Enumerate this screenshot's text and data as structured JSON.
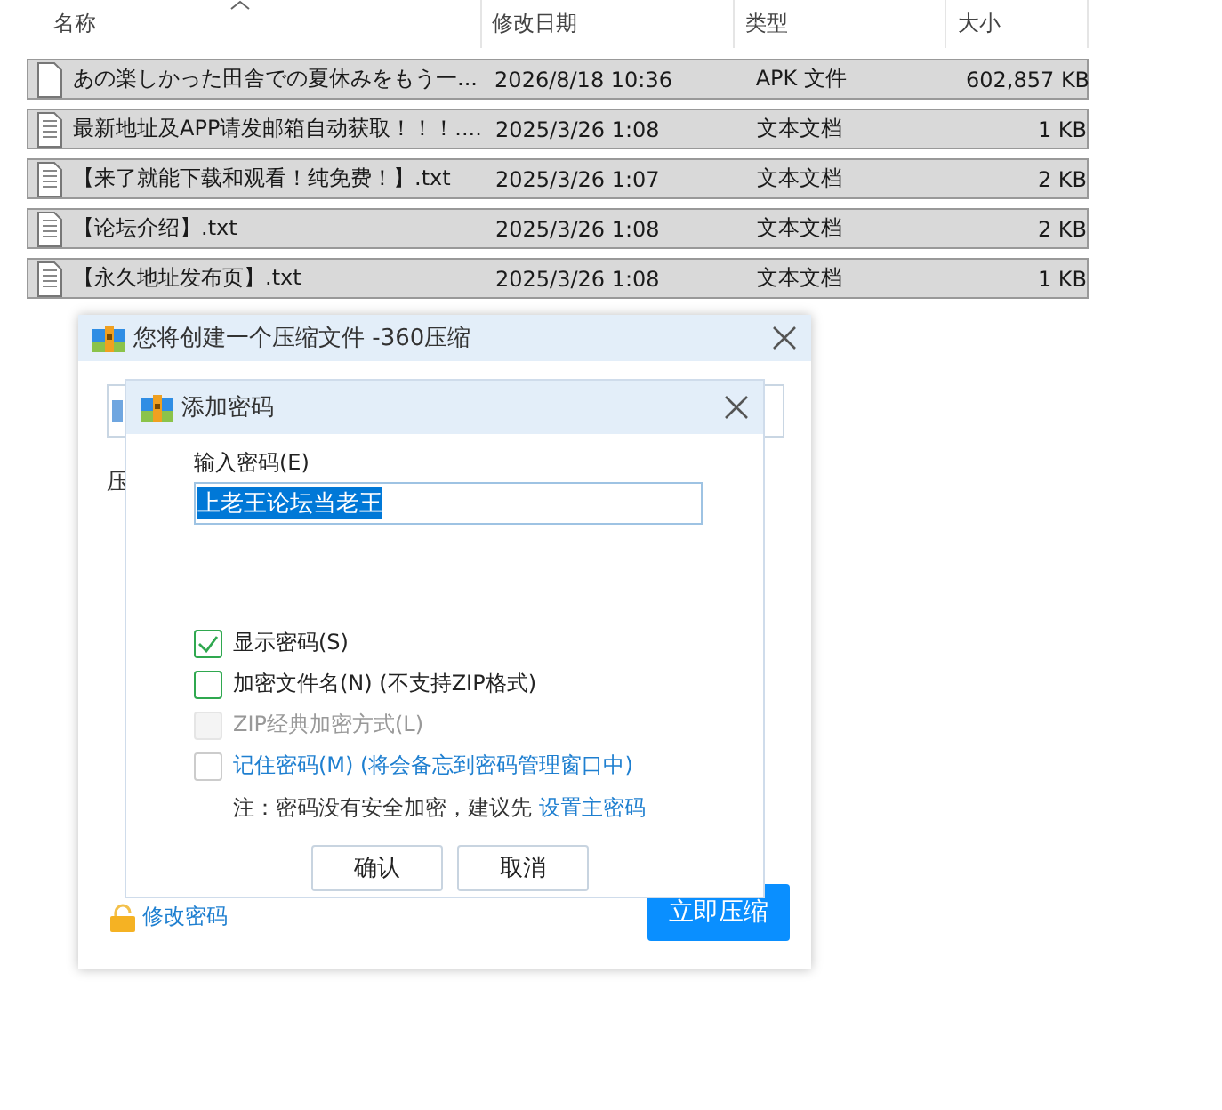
{
  "file_list": {
    "columns": [
      {
        "label": "名称",
        "sorted": true
      },
      {
        "label": "修改日期",
        "sorted": false
      },
      {
        "label": "类型",
        "sorted": false
      },
      {
        "label": "大小",
        "sorted": false
      }
    ],
    "rows": [
      {
        "kind": "blank",
        "name": "あの楽しかった田舎での夏休みをもう一...",
        "date": "2026/8/18 10:36",
        "type": "APK 文件",
        "size": "602,857 KB",
        "selected": true
      },
      {
        "kind": "text",
        "name": "最新地址及APP请发邮箱自动获取！！！....",
        "date": "2025/3/26 1:08",
        "type": "文本文档",
        "size": "1 KB",
        "selected": true
      },
      {
        "kind": "text",
        "name": "【来了就能下载和观看！纯免费！】.txt",
        "date": "2025/3/26 1:07",
        "type": "文本文档",
        "size": "2 KB",
        "selected": true
      },
      {
        "kind": "text",
        "name": "【论坛介绍】.txt",
        "date": "2025/3/26 1:08",
        "type": "文本文档",
        "size": "2 KB",
        "selected": true
      },
      {
        "kind": "text",
        "name": "【永久地址发布页】.txt",
        "date": "2025/3/26 1:08",
        "type": "文本文档",
        "size": "1 KB",
        "selected": true
      }
    ]
  },
  "compress_dialog": {
    "title": "您将创建一个压缩文件 -360压缩",
    "label": "压",
    "change_password_link": "修改密码",
    "compress_button": "立即压缩"
  },
  "password_dialog": {
    "title": "添加密码",
    "password_label": "输入密码(E)",
    "password_value": "上老王论坛当老王",
    "options": [
      {
        "label": "显示密码(S)",
        "checked": true,
        "disabled": false,
        "link": false
      },
      {
        "label": "加密文件名(N) (不支持ZIP格式)",
        "checked": false,
        "disabled": false,
        "link": false
      },
      {
        "label": "ZIP经典加密方式(L)",
        "checked": false,
        "disabled": true,
        "link": false
      },
      {
        "label": "记住密码(M) (将会备忘到密码管理窗口中)",
        "checked": false,
        "disabled": false,
        "link": true
      }
    ],
    "note": "注：密码没有安全加密，建议先",
    "note_link": "设置主密码",
    "buttons": [
      "确认",
      "取消"
    ]
  }
}
